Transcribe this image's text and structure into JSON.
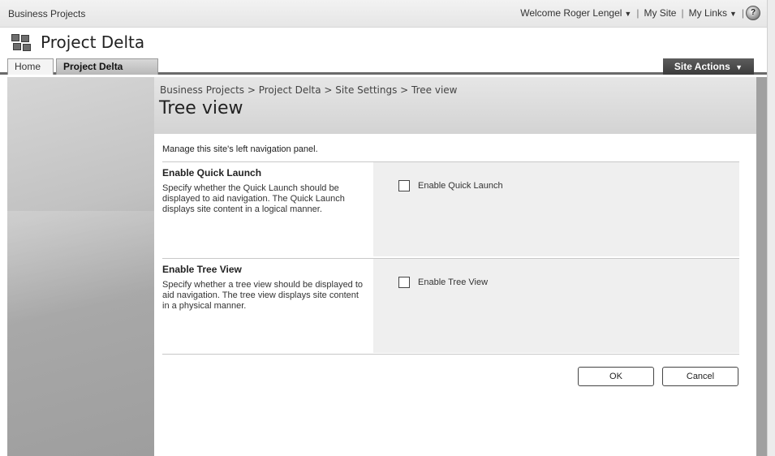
{
  "top": {
    "site_crumb": "Business Projects",
    "welcome": "Welcome Roger Lengel",
    "my_site": "My Site",
    "my_links": "My Links",
    "separator": "|"
  },
  "header": {
    "site_title": "Project Delta"
  },
  "tabs": [
    {
      "label": "Home"
    },
    {
      "label": "Project Delta"
    }
  ],
  "site_actions": "Site Actions",
  "page": {
    "breadcrumb": "Business Projects > Project Delta > Site Settings > Tree view",
    "title": "Tree view",
    "description": "Manage this site's left navigation panel."
  },
  "sections": [
    {
      "title": "Enable Quick Launch",
      "body": "Specify whether the Quick Launch should be displayed to aid navigation. The Quick Launch displays site content in a logical manner.",
      "checkbox_label": "Enable Quick Launch",
      "checked": false
    },
    {
      "title": "Enable Tree View",
      "body": "Specify whether a tree view should be displayed to aid navigation.  The tree view displays site content in a physical manner.",
      "checkbox_label": "Enable Tree View",
      "checked": false
    }
  ],
  "buttons": {
    "ok": "OK",
    "cancel": "Cancel"
  },
  "icons": {
    "help": "help-icon",
    "logo": "site-logo-icon",
    "dropdown": "caret-down-icon"
  }
}
